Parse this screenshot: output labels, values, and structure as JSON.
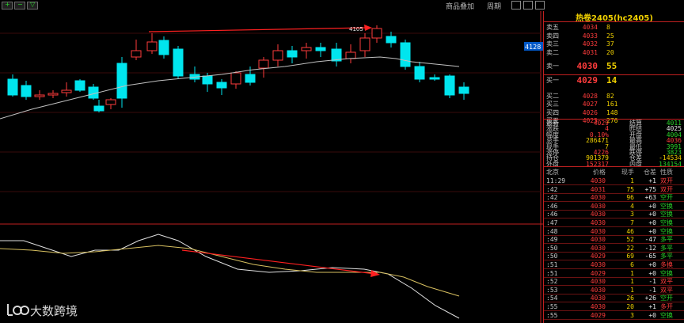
{
  "toolbar": {
    "buttons": [
      "+",
      "−",
      "▽"
    ],
    "overlay_label": "商品叠加",
    "period_label": "周期"
  },
  "chart": {
    "price_tag": "4128",
    "annotation": "4105",
    "colors": {
      "up": "#ff3c3c",
      "down": "#00e5ee",
      "ma": "#c0c0c0",
      "arrow": "#ff2020"
    }
  },
  "panel": {
    "title": "热卷2405(hc2405)",
    "asks": [
      {
        "label": "卖五",
        "price": "4034",
        "vol": "8"
      },
      {
        "label": "卖四",
        "price": "4033",
        "vol": "25"
      },
      {
        "label": "卖三",
        "price": "4032",
        "vol": "37"
      },
      {
        "label": "卖二",
        "price": "4031",
        "vol": "20"
      },
      {
        "label": "卖一",
        "price": "4030",
        "vol": "55"
      }
    ],
    "bids": [
      {
        "label": "买一",
        "price": "4029",
        "vol": "14"
      },
      {
        "label": "买二",
        "price": "4028",
        "vol": "82"
      },
      {
        "label": "买三",
        "price": "4027",
        "vol": "161"
      },
      {
        "label": "买四",
        "price": "4026",
        "vol": "148"
      },
      {
        "label": "买五",
        "price": "4025",
        "vol": "276"
      }
    ],
    "quotes": [
      {
        "l1": "最新",
        "v1": "4029",
        "c1": "red",
        "l2": "结算",
        "v2": "4011",
        "c2": "green"
      },
      {
        "l1": "涨跌",
        "v1": "4",
        "c1": "red",
        "l2": "昨结",
        "v2": "4025",
        "c2": "white"
      },
      {
        "l1": "幅度",
        "v1": "0.10%",
        "c1": "red",
        "l2": "开盘",
        "v2": "4004",
        "c2": "green"
      },
      {
        "l1": "总手",
        "v1": "286471",
        "c1": "yellow",
        "l2": "最高",
        "v2": "4036",
        "c2": "red"
      },
      {
        "l1": "现手",
        "v1": "7",
        "c1": "yellow",
        "l2": "最低",
        "v2": "3991",
        "c2": "green"
      },
      {
        "l1": "涨停",
        "v1": "4226",
        "c1": "red",
        "l2": "跌停",
        "v2": "3823",
        "c2": "green"
      },
      {
        "l1": "持仓",
        "v1": "901379",
        "c1": "yellow",
        "l2": "仓差",
        "v2": "-14534",
        "c2": "yellow"
      },
      {
        "l1": "外盘",
        "v1": "152317",
        "c1": "red",
        "l2": "内盘",
        "v2": "134154",
        "c2": "green"
      }
    ],
    "ticks_header": {
      "time": "北京",
      "price": "价格",
      "vol": "现手",
      "oi": "仓差",
      "type": "性质"
    },
    "ticks": [
      {
        "time": "11:29",
        "price": "4030",
        "vol": "1",
        "oi": "+1",
        "type": "双开",
        "pc": "red",
        "tc": "red"
      },
      {
        "time": ":42",
        "price": "4031",
        "vol": "75",
        "oi": "+75",
        "type": "双开",
        "pc": "red",
        "tc": "red"
      },
      {
        "time": ":42",
        "price": "4030",
        "vol": "96",
        "oi": "+63",
        "type": "空开",
        "pc": "red",
        "tc": "green"
      },
      {
        "time": ":46",
        "price": "4030",
        "vol": "4",
        "oi": "+0",
        "type": "空换",
        "pc": "red",
        "tc": "green"
      },
      {
        "time": ":46",
        "price": "4030",
        "vol": "3",
        "oi": "+0",
        "type": "空换",
        "pc": "red",
        "tc": "green"
      },
      {
        "time": ":47",
        "price": "4030",
        "vol": "7",
        "oi": "+0",
        "type": "空换",
        "pc": "red",
        "tc": "green"
      },
      {
        "time": ":48",
        "price": "4030",
        "vol": "46",
        "oi": "+0",
        "type": "空换",
        "pc": "red",
        "tc": "green"
      },
      {
        "time": ":49",
        "price": "4030",
        "vol": "52",
        "oi": "-47",
        "type": "多平",
        "pc": "red",
        "tc": "green"
      },
      {
        "time": ":50",
        "price": "4030",
        "vol": "22",
        "oi": "-12",
        "type": "多平",
        "pc": "red",
        "tc": "green"
      },
      {
        "time": ":50",
        "price": "4029",
        "vol": "69",
        "oi": "-65",
        "type": "多平",
        "pc": "red",
        "tc": "green"
      },
      {
        "time": ":51",
        "price": "4030",
        "vol": "6",
        "oi": "+0",
        "type": "多换",
        "pc": "red",
        "tc": "red"
      },
      {
        "time": ":51",
        "price": "4029",
        "vol": "1",
        "oi": "+0",
        "type": "空换",
        "pc": "red",
        "tc": "green"
      },
      {
        "time": ":52",
        "price": "4030",
        "vol": "1",
        "oi": "-1",
        "type": "双平",
        "pc": "red",
        "tc": "red"
      },
      {
        "time": ":53",
        "price": "4030",
        "vol": "1",
        "oi": "-1",
        "type": "双平",
        "pc": "red",
        "tc": "red"
      },
      {
        "time": ":54",
        "price": "4030",
        "vol": "26",
        "oi": "+26",
        "type": "空开",
        "pc": "red",
        "tc": "green"
      },
      {
        "time": ":55",
        "price": "4030",
        "vol": "20",
        "oi": "+1",
        "type": "多开",
        "pc": "red",
        "tc": "red"
      },
      {
        "time": ":55",
        "price": "4029",
        "vol": "3",
        "oi": "+0",
        "type": "空换",
        "pc": "red",
        "tc": "green"
      }
    ]
  },
  "watermark": {
    "text": "大数跨境"
  }
}
